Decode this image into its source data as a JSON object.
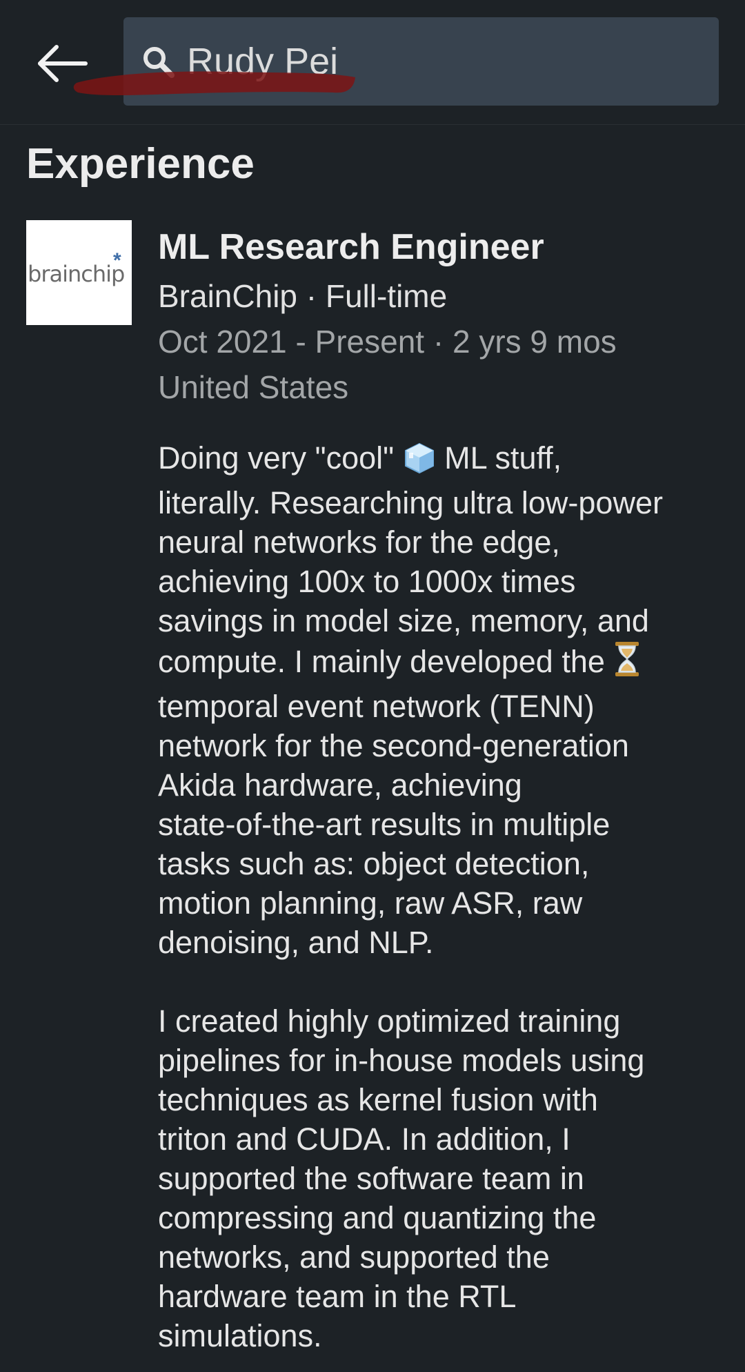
{
  "header": {
    "back_icon": "arrow-left-icon",
    "search_icon": "search-icon",
    "search_value": "Rudy Pei"
  },
  "section": {
    "title": "Experience"
  },
  "experience": {
    "logo_text": "brainchip",
    "logo_mark": "*",
    "job_title": "ML Research Engineer",
    "company_line": "BrainChip · Full-time",
    "dates_line": "Oct 2021 - Present · 2 yrs 9 mos",
    "location": "United States",
    "description": {
      "p1": {
        "l1a": "Doing very \"cool\" ",
        "l1_icon": "ice-cube-icon",
        "l1b": " ML stuff,",
        "l2": "literally. Researching ultra low-power",
        "l3": "neural networks for the edge,",
        "l4": "achieving 100x to 1000x times",
        "l5": "savings in model size, memory, and",
        "l6a": "compute. I mainly developed the ",
        "l6_icon": "hourglass-icon",
        "l7": "temporal event network (TENN)",
        "l8": "network for the second-generation",
        "l9": "Akida hardware, achieving",
        "l10": "state-of-the-art results in multiple",
        "l11": "tasks such as: object detection,",
        "l12": "motion planning, raw ASR, raw",
        "l13": "denoising, and NLP."
      },
      "p2": {
        "l1": "I created highly optimized training",
        "l2": "pipelines for in-house models using",
        "l3": "techniques as kernel fusion with",
        "l4": "triton and CUDA. In addition, I",
        "l5": "supported the software team in",
        "l6": "compressing and quantizing the",
        "l7": "networks, and supported the",
        "l8": "hardware team in the RTL",
        "l9": "simulations."
      }
    }
  },
  "colors": {
    "background": "#1d2226",
    "search_box": "#38434f",
    "redaction": "#8b1a1a",
    "secondary_text": "#a3a6a8"
  }
}
